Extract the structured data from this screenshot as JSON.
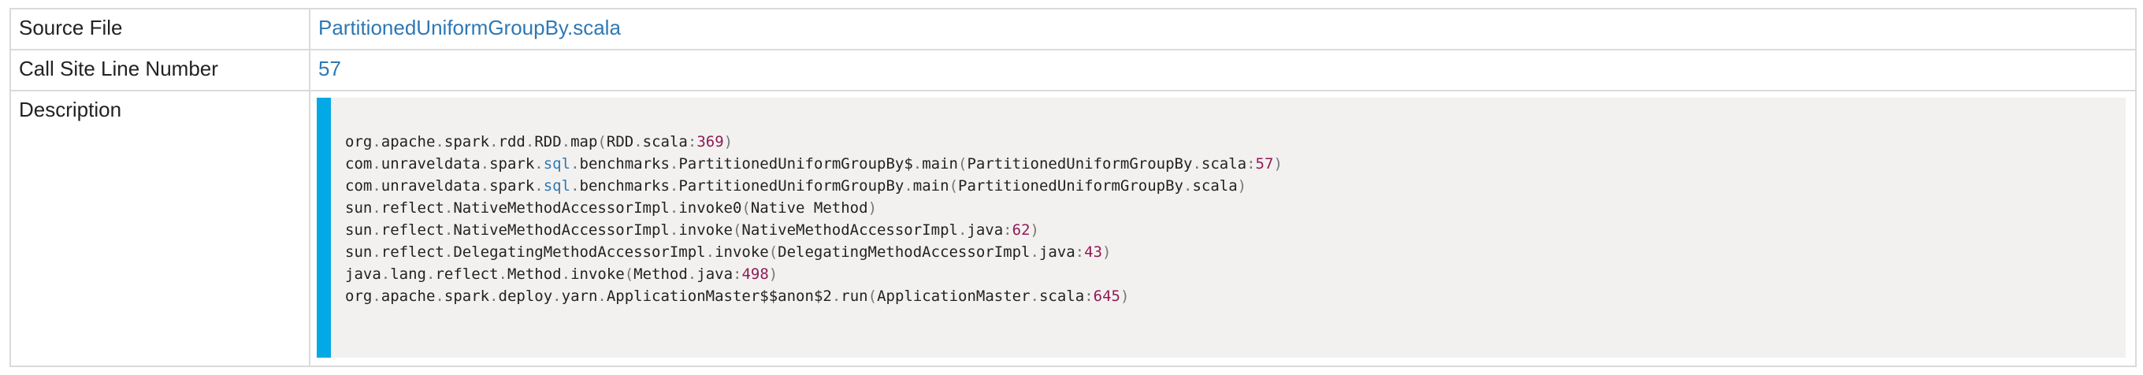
{
  "rows": {
    "source_file": {
      "label": "Source File",
      "value": "PartitionedUniformGroupBy.scala"
    },
    "call_site": {
      "label": "Call Site Line Number",
      "value": "57"
    },
    "description": {
      "label": "Description"
    }
  },
  "stack_trace": [
    "org.apache.spark.rdd.RDD.map(RDD.scala:369)",
    "com.unraveldata.spark.sql.benchmarks.PartitionedUniformGroupBy$.main(PartitionedUniformGroupBy.scala:57)",
    "com.unraveldata.spark.sql.benchmarks.PartitionedUniformGroupBy.main(PartitionedUniformGroupBy.scala)",
    "sun.reflect.NativeMethodAccessorImpl.invoke0(Native Method)",
    "sun.reflect.NativeMethodAccessorImpl.invoke(NativeMethodAccessorImpl.java:62)",
    "sun.reflect.DelegatingMethodAccessorImpl.invoke(DelegatingMethodAccessorImpl.java:43)",
    "java.lang.reflect.Method.invoke(Method.java:498)",
    "org.apache.spark.deploy.yarn.ApplicationMaster$$anon$2.run(ApplicationMaster.scala:645)"
  ],
  "colors": {
    "link": "#2e78b5",
    "accent_bar": "#03a9e4",
    "code_background": "#f3f1ef",
    "number": "#8e1b5a"
  }
}
